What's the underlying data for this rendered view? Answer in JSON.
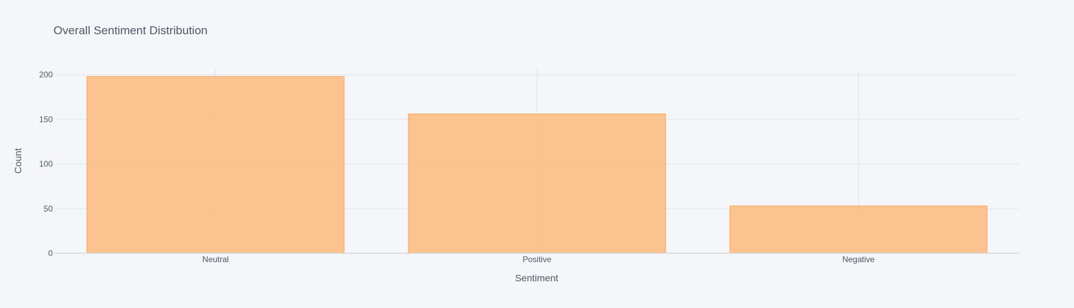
{
  "chart_data": {
    "type": "bar",
    "title": "Overall Sentiment Distribution",
    "xlabel": "Sentiment",
    "ylabel": "Count",
    "categories": [
      "Neutral",
      "Positive",
      "Negative"
    ],
    "values": [
      198,
      156,
      53
    ],
    "ylim": [
      0,
      207
    ],
    "yticks": [
      0,
      50,
      100,
      150,
      200
    ],
    "grid": true,
    "legend": "none",
    "colors": {
      "bar_fill": "#FBBE84",
      "bar_edge": "#F8A65B",
      "background": "#F5F6F9",
      "text": "#4D5663",
      "grid": "#E1E5ED"
    }
  }
}
